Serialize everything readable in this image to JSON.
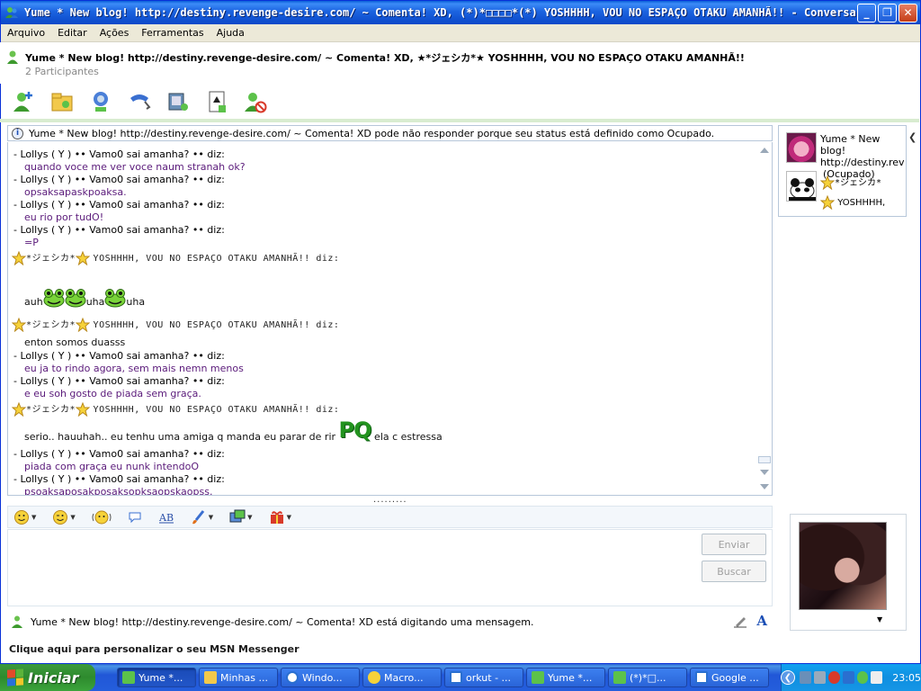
{
  "window": {
    "title": "Yume * New blog! http://destiny.revenge-desire.com/ ~ Comenta! XD, (*)*□□□□*(*) YOSHHHH, VOU NO ESPAÇO OTAKU AMANHÃ!! - Conversa"
  },
  "menu": [
    "Arquivo",
    "Editar",
    "Ações",
    "Ferramentas",
    "Ajuda"
  ],
  "header": {
    "title": "Yume * New blog! http://destiny.revenge-desire.com/ ~ Comenta! XD, ★*ジェシカ*★ YOSHHHH, VOU NO ESPAÇO OTAKU AMANHÃ!!",
    "participants": "2 Participantes"
  },
  "notice": "Yume * New blog! http://destiny.revenge-desire.com/ ~ Comenta! XD pode não responder porque seu status está definido como Ocupado.",
  "chat": {
    "lollys": "- Lollys ( Y ) •• Vamo0 sai amanha? •• diz:",
    "jessica_suffix": "YOSHHHH, VOU NO ESPAÇO OTAKU AMANHÃ!! diz:",
    "jessica_name": "*ジェシカ*",
    "msgs": {
      "m1": "quando voce me ver voce naum stranah ok?",
      "m2": "opsaksapaskpoaksa.",
      "m3": "eu rio por tudO!",
      "m4": "=P",
      "m5a": "auh",
      "m5b": "uha",
      "m5c": "uha",
      "m6": "enton somos duasss",
      "m7": "eu ja to rindo agora, sem mais nemn menos",
      "m8": "e eu soh gosto de piada sem graça.",
      "m9a": "serio.. hauuhah.. eu tenhu uma amiga q manda eu parar de rir",
      "m9pq": "PQ",
      "m9b": "ela c estressa",
      "m10": "piada com graça eu nunk intendoO",
      "m11": "psoaksaposakposaksopksaopskaopss."
    }
  },
  "compose": {
    "send": "Enviar",
    "search": "Buscar"
  },
  "typing": "Yume * New blog! http://destiny.revenge-desire.com/ ~ Comenta! XD está digitando uma mensagem.",
  "personalize": "Clique aqui para personalizar o seu MSN Messenger",
  "side": {
    "p1_line1": "Yume * New blog!",
    "p1_line2": "http://destiny.rev",
    "p1_line3": "(Ocupado)",
    "p2_name": "*ジェシカ*",
    "p2_line2": "YOSHHHH,"
  },
  "taskbar": {
    "start": "Iniciar",
    "tasks": [
      "Yume *...",
      "Minhas ...",
      "Windo...",
      "Macro...",
      "orkut - ...",
      "Yume *...",
      "(*)*□...",
      "Google ..."
    ],
    "clock": "23:05"
  },
  "colors": {
    "title_bar": "#1b63e0",
    "msg_text": "#5a1a7a",
    "pq_green": "#23931f",
    "start_green": "#2e8b2e"
  }
}
